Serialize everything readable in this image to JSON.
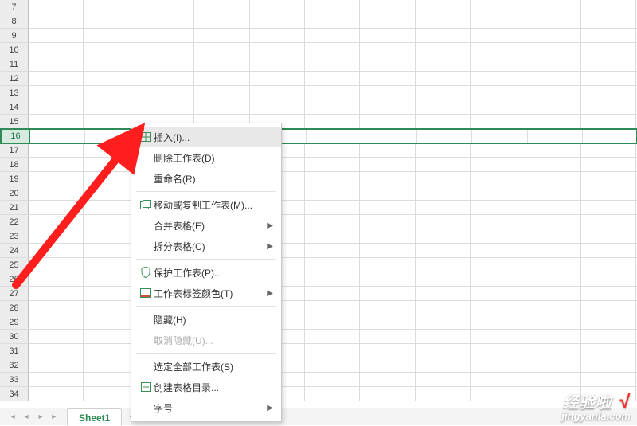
{
  "rows": {
    "start": 7,
    "end": 34,
    "active": 16
  },
  "columns_count": 11,
  "sheet_tab": {
    "name": "Sheet1"
  },
  "context_menu": {
    "insert": "插入(I)...",
    "delete_sheet": "删除工作表(D)",
    "rename": "重命名(R)",
    "move_copy": "移动或复制工作表(M)...",
    "merge": "合并表格(E)",
    "split": "拆分表格(C)",
    "protect": "保护工作表(P)...",
    "tab_color": "工作表标签颜色(T)",
    "hide": "隐藏(H)",
    "unhide": "取消隐藏(U)...",
    "select_all": "选定全部工作表(S)",
    "create_index": "创建表格目录...",
    "font_size": "字号"
  },
  "watermark": {
    "title": "经验啦",
    "check": "√",
    "url": "jingyanla.com"
  }
}
